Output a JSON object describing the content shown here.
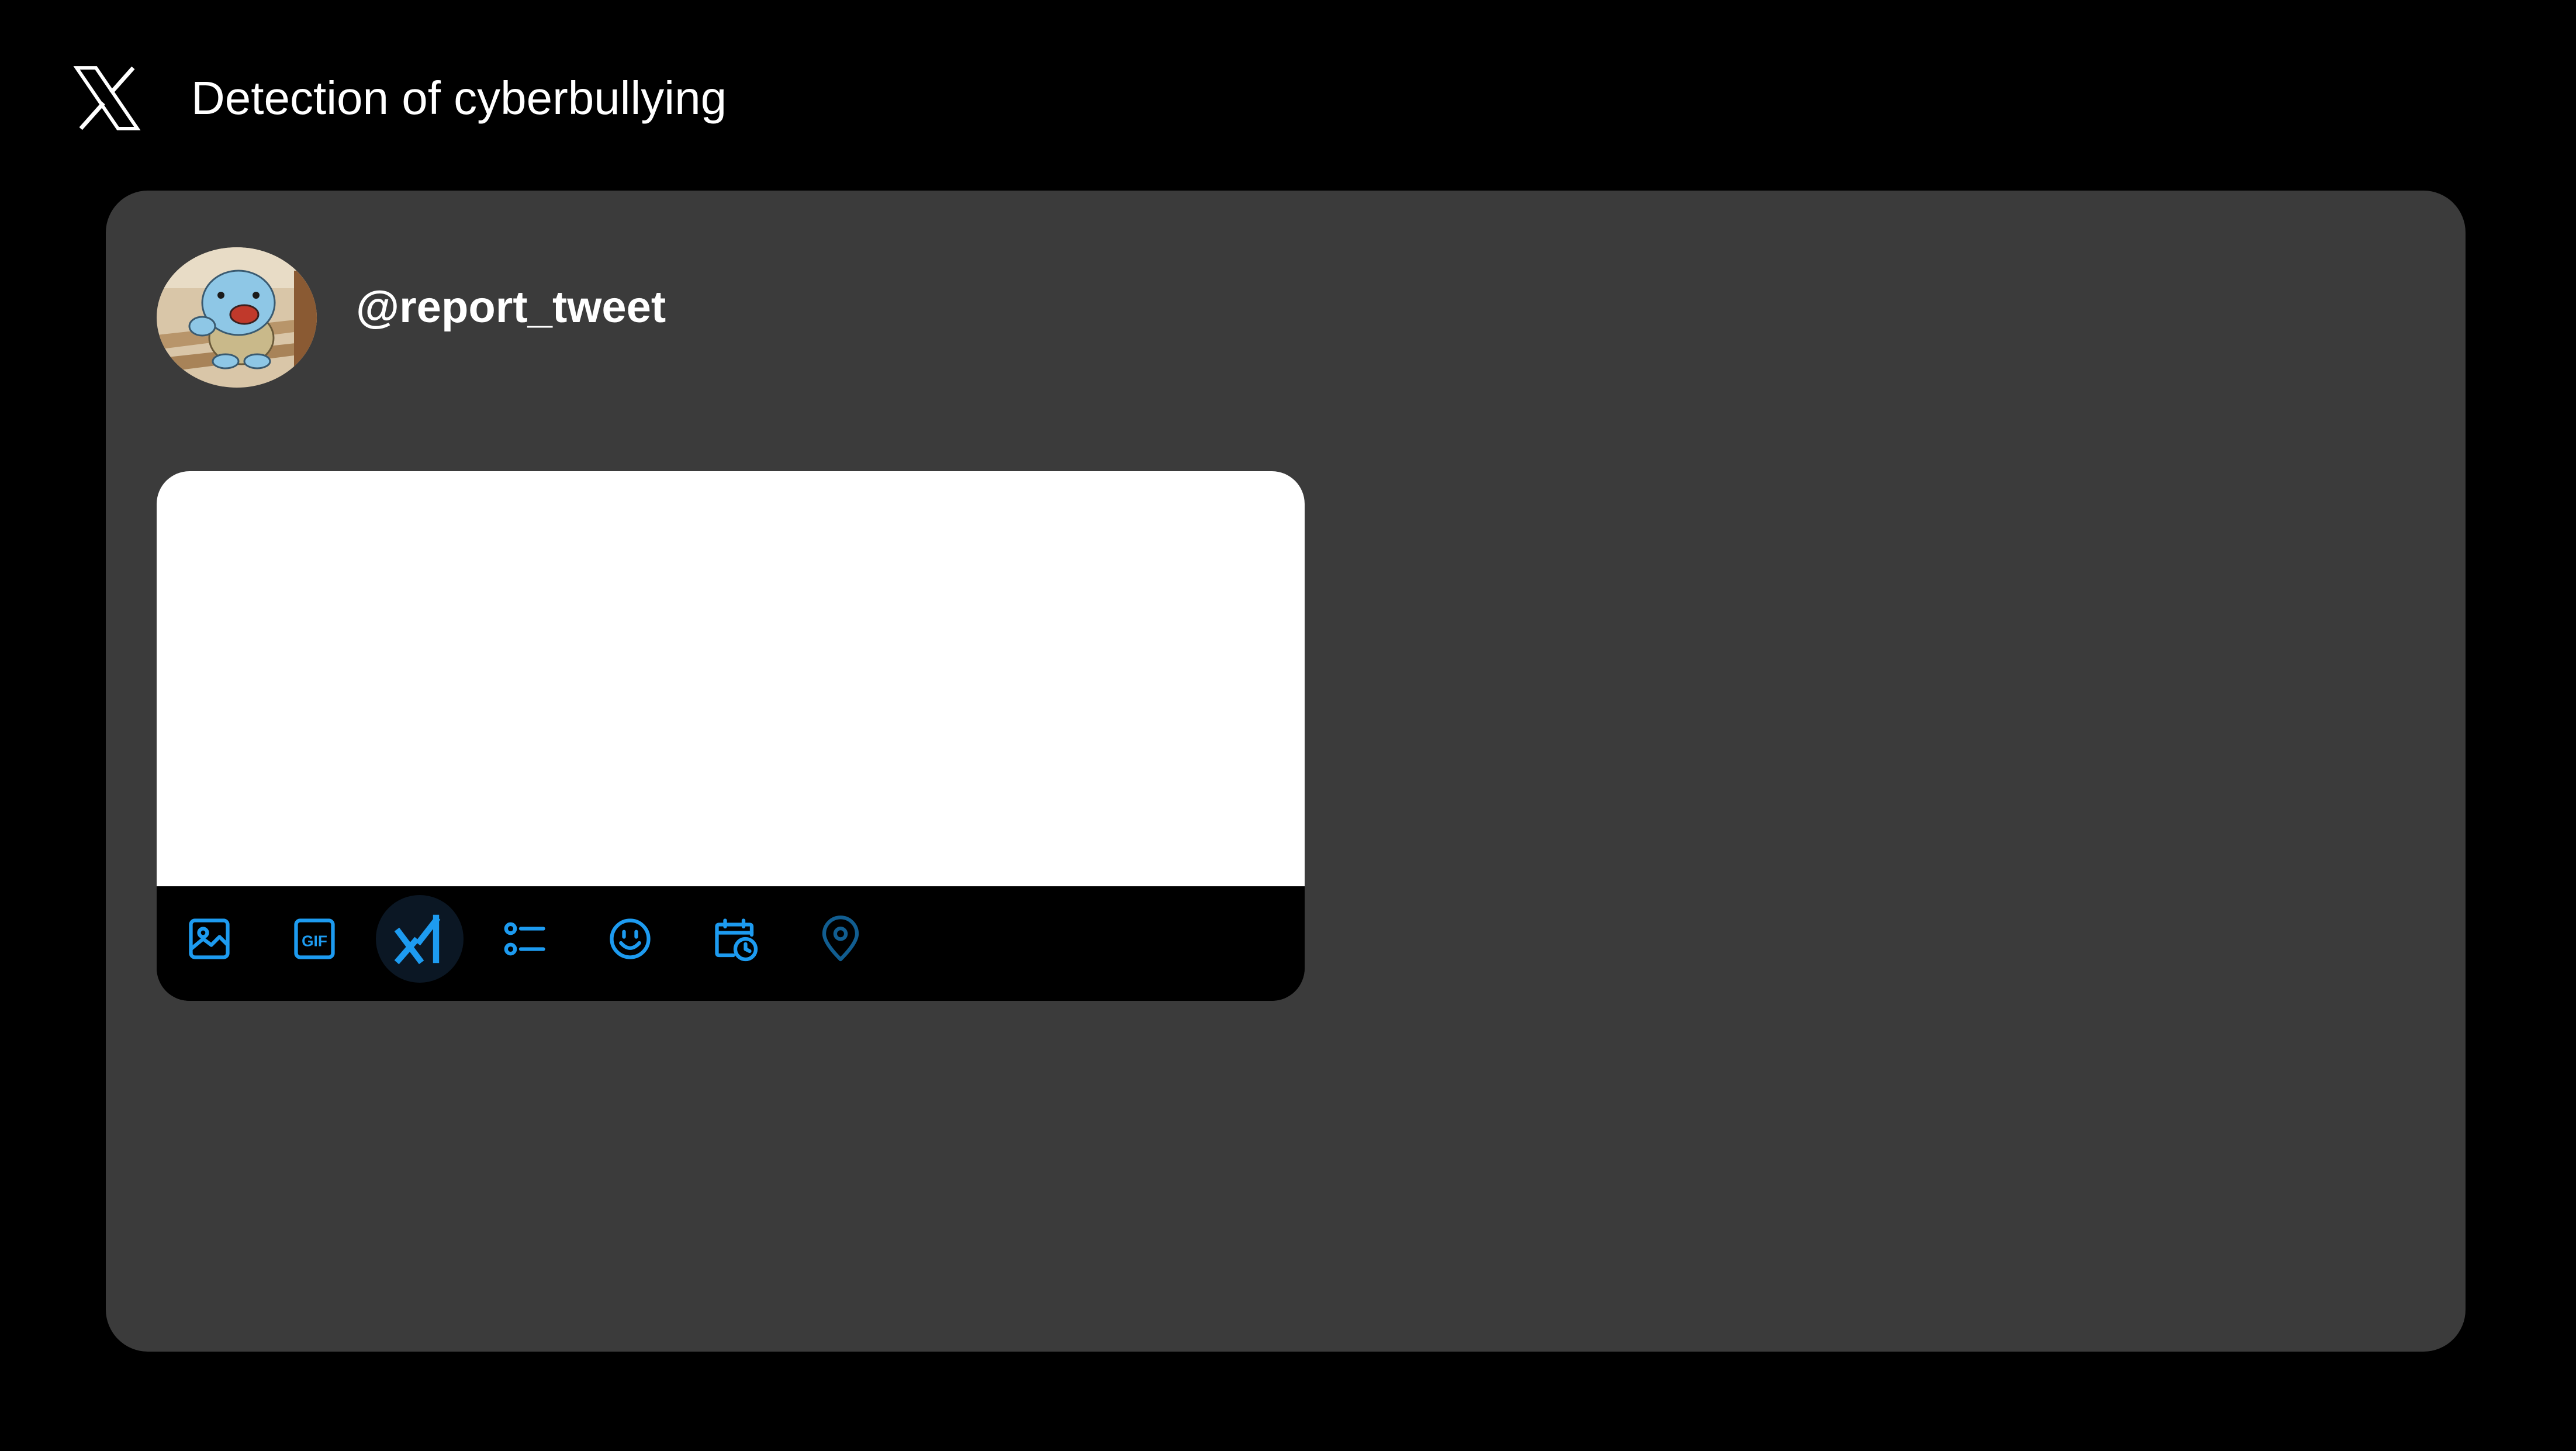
{
  "header": {
    "logo_icon": "x-logo-icon",
    "title": "Detection of cyberbullying"
  },
  "post": {
    "avatar_icon": "squirtle-avatar",
    "handle": "@report_tweet",
    "compose_value": "",
    "toolbar": [
      {
        "name": "image-icon",
        "label": "Media"
      },
      {
        "name": "gif-icon",
        "label": "GIF"
      },
      {
        "name": "grok-icon",
        "label": "Grok"
      },
      {
        "name": "poll-icon",
        "label": "Poll"
      },
      {
        "name": "emoji-icon",
        "label": "Emoji"
      },
      {
        "name": "schedule-icon",
        "label": "Schedule"
      },
      {
        "name": "location-icon",
        "label": "Location"
      }
    ]
  },
  "colors": {
    "background": "#000000",
    "card": "#3b3b3b",
    "accent": "#1d9bf0",
    "text": "#ffffff"
  }
}
